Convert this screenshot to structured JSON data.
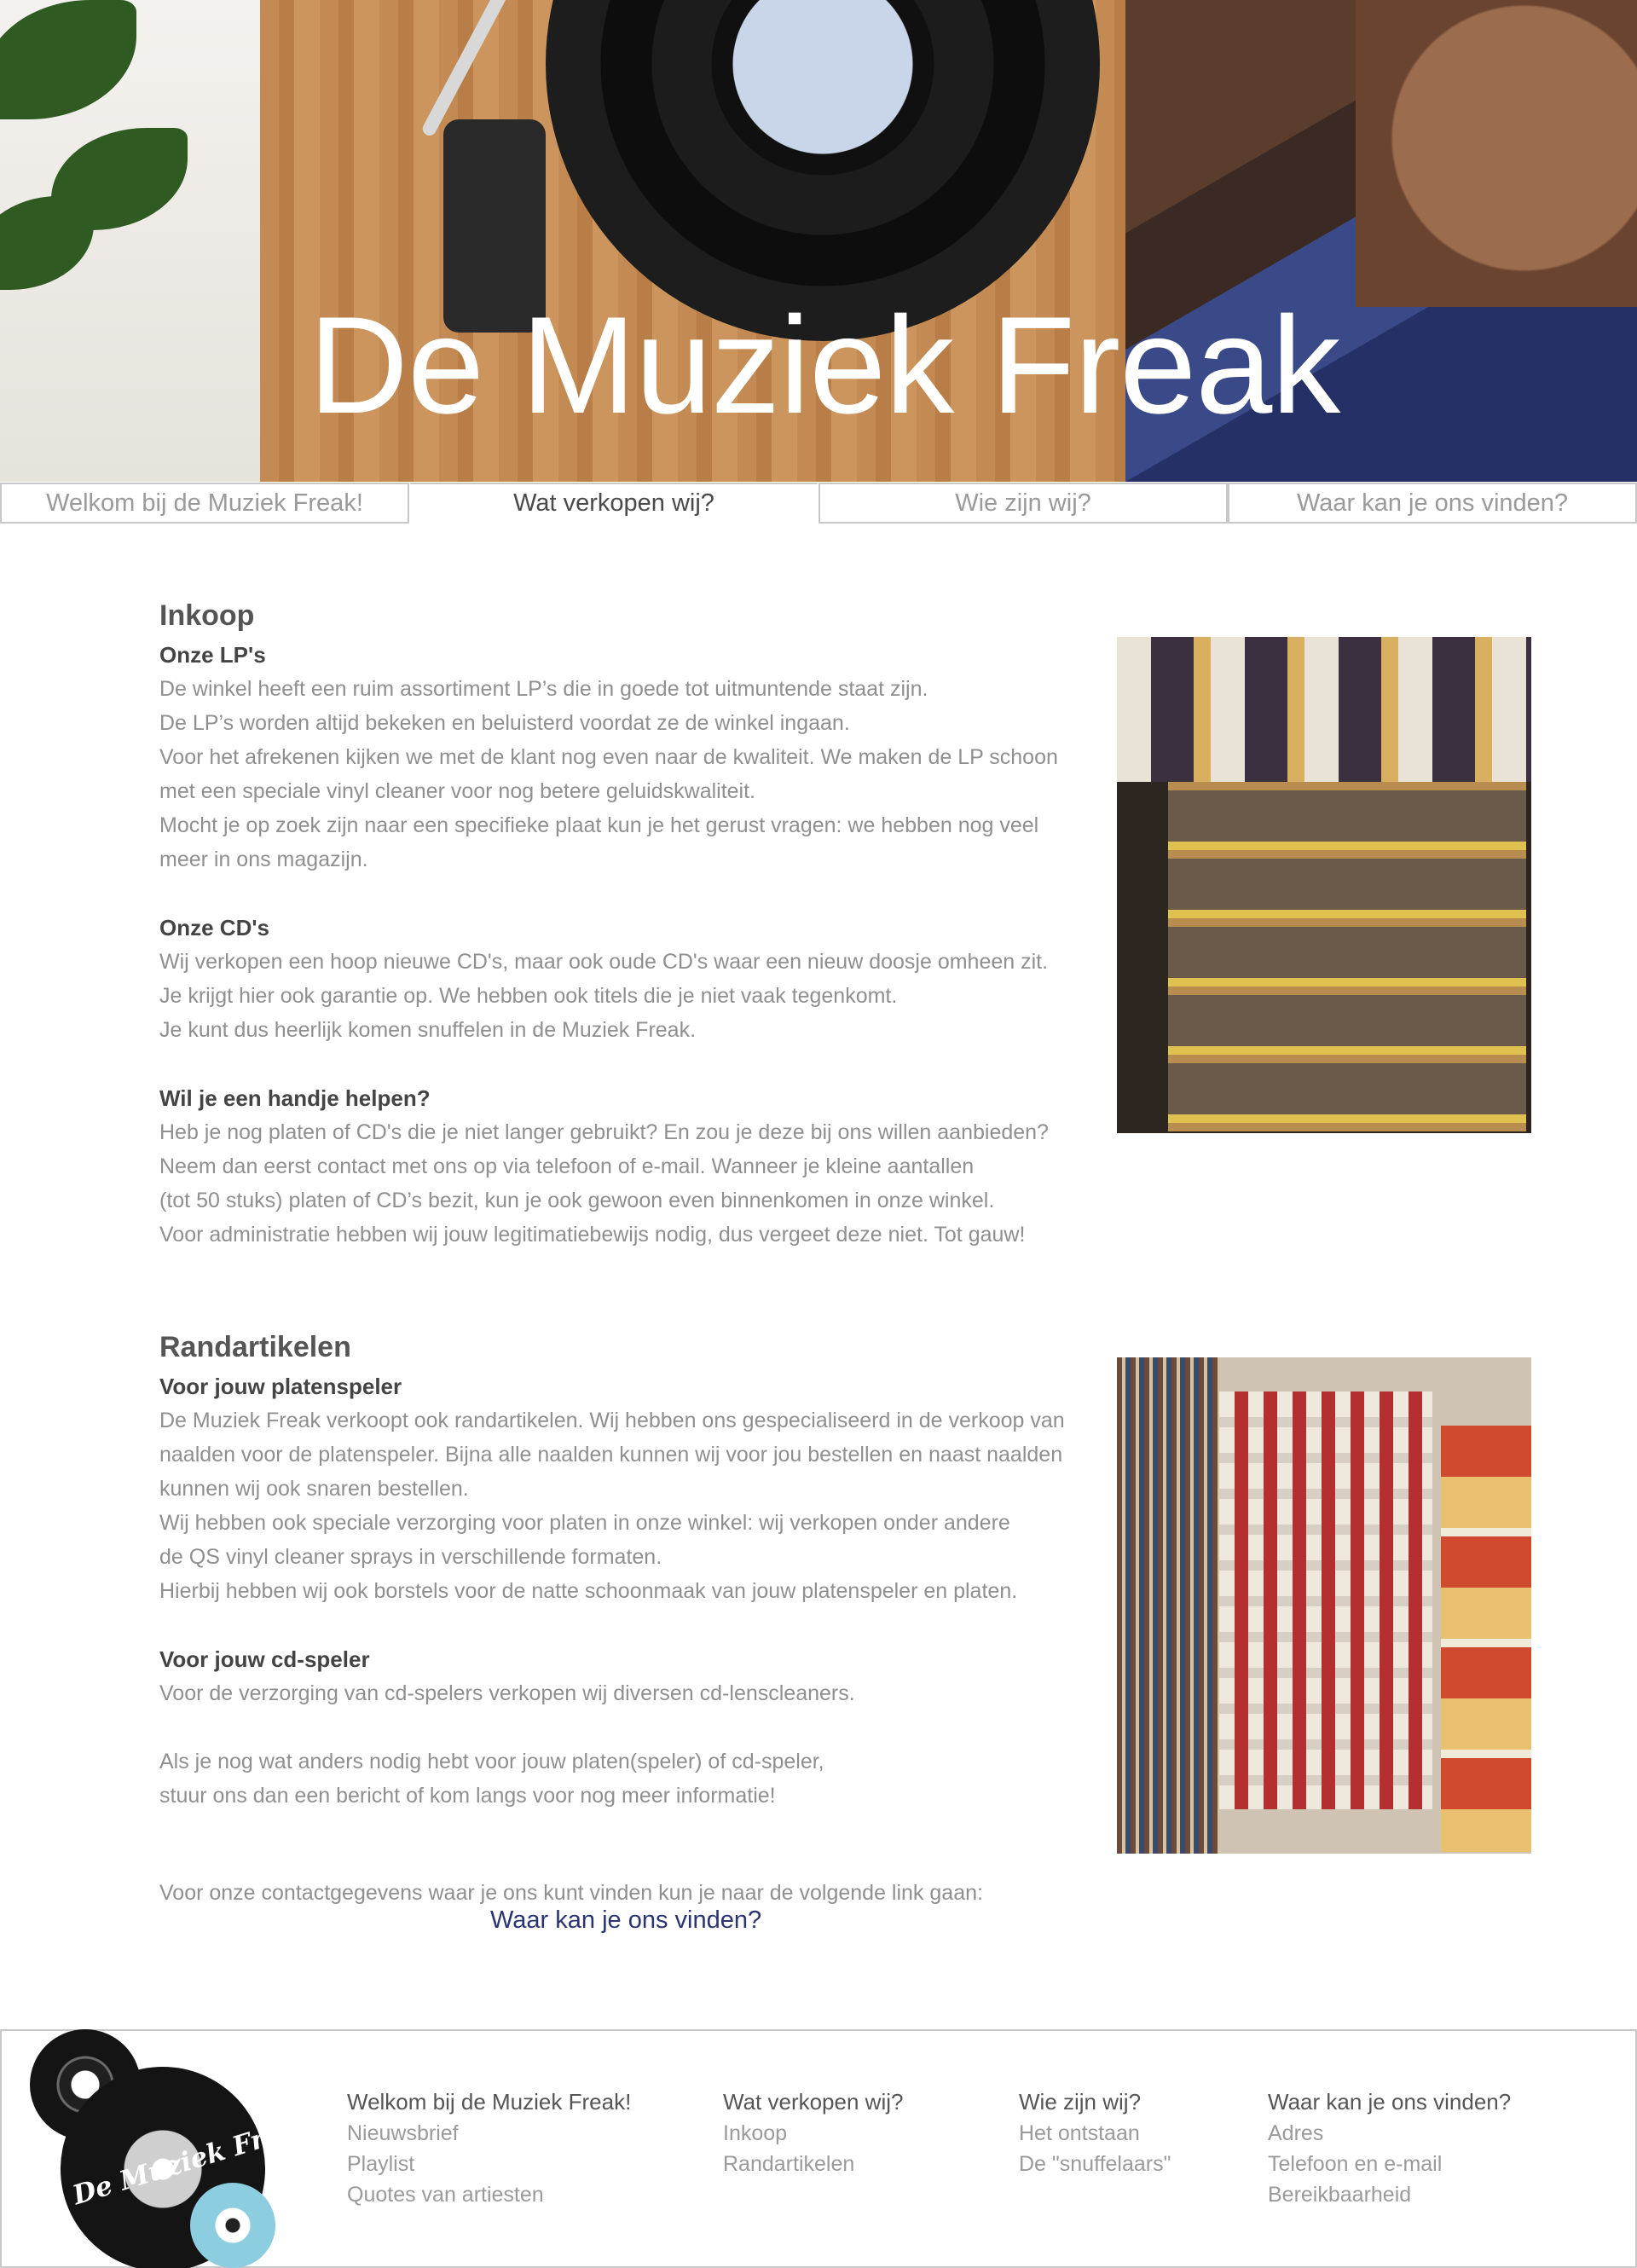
{
  "hero": {
    "title": "De Muziek Freak"
  },
  "nav": {
    "items": [
      {
        "label": "Welkom bij de Muziek Freak!",
        "active": false
      },
      {
        "label": "Wat verkopen wij?",
        "active": true
      },
      {
        "label": "Wie zijn wij?",
        "active": false
      },
      {
        "label": "Waar kan je ons vinden?",
        "active": false
      }
    ]
  },
  "sections": [
    {
      "title": "Inkoop",
      "blocks": [
        {
          "subtitle": "Onze LP's",
          "lines": [
            "De winkel heeft een ruim assortiment LP’s die in goede tot uitmuntende staat zijn.",
            "De LP’s worden altijd bekeken en beluisterd voordat ze de winkel ingaan.",
            "Voor het afrekenen kijken we met de klant nog even naar de kwaliteit. We maken de LP schoon",
            "met een speciale vinyl cleaner voor nog betere geluidskwaliteit.",
            "Mocht je op zoek zijn naar een specifieke plaat kun je het gerust vragen: we hebben nog veel",
            "meer in ons magazijn."
          ]
        },
        {
          "subtitle": "Onze CD's",
          "lines": [
            "Wij verkopen een hoop nieuwe CD's, maar ook oude CD's waar een nieuw doosje omheen zit.",
            "Je krijgt hier ook garantie op. We hebben ook titels die je niet vaak tegenkomt.",
            "Je kunt dus heerlijk komen snuffelen in de Muziek Freak."
          ]
        },
        {
          "subtitle": "Wil je een handje helpen?",
          "lines": [
            "Heb je nog platen of CD's die je niet langer gebruikt? En zou je deze bij ons willen aanbieden?",
            "Neem dan eerst contact met ons op via telefoon of e-mail. Wanneer je kleine aantallen",
            "(tot 50 stuks) platen of CD’s bezit, kun je ook gewoon even binnenkomen in onze winkel.",
            "Voor administratie hebben wij jouw legitimatiebewijs nodig, dus vergeet deze niet. Tot gauw!"
          ]
        }
      ]
    },
    {
      "title": "Randartikelen",
      "blocks": [
        {
          "subtitle": "Voor jouw platenspeler",
          "lines": [
            "De Muziek Freak verkoopt ook randartikelen. Wij hebben ons gespecialiseerd in de verkoop van",
            "naalden voor de platenspeler. Bijna alle naalden kunnen wij voor jou bestellen en naast naalden",
            "kunnen wij ook snaren bestellen.",
            "Wij hebben ook speciale verzorging voor platen in onze winkel: wij verkopen onder andere",
            "de QS vinyl cleaner sprays in verschillende formaten.",
            "Hierbij hebben wij ook borstels voor de natte schoonmaak van jouw platenspeler en platen."
          ]
        },
        {
          "subtitle": "Voor jouw cd-speler",
          "lines": [
            "Voor de verzorging van cd-spelers verkopen wij diversen cd-lenscleaners."
          ]
        },
        {
          "subtitle": "",
          "lines": [
            "Als je nog wat anders nodig hebt voor jouw platen(speler) of cd-speler,",
            "stuur ons dan een bericht of kom langs voor nog meer informatie!"
          ]
        }
      ]
    }
  ],
  "contact": {
    "text": "Voor onze contactgegevens waar je ons kunt vinden kun je naar de volgende link gaan:",
    "link": "Waar kan je ons vinden?"
  },
  "footer": {
    "logo_text": "De Muziek Freak",
    "columns": [
      {
        "heading": "Welkom bij de Muziek Freak!",
        "links": [
          "Nieuwsbrief",
          "Playlist",
          "Quotes van artiesten"
        ]
      },
      {
        "heading": "Wat verkopen wij?",
        "links": [
          "Inkoop",
          "Randartikelen"
        ]
      },
      {
        "heading": "Wie zijn wij?",
        "links": [
          "Het ontstaan",
          "De \"snuffelaars\""
        ]
      },
      {
        "heading": "Waar kan je ons vinden?",
        "links": [
          "Adres",
          "Telefoon en e-mail",
          "Bereikbaarheid"
        ]
      }
    ]
  },
  "colors": {
    "accent_link": "#2b3470",
    "nav_border": "#c8c8c8",
    "body_text": "#8f8f8f"
  },
  "icons": {
    "logo": "vinyl-records-logo-icon"
  }
}
